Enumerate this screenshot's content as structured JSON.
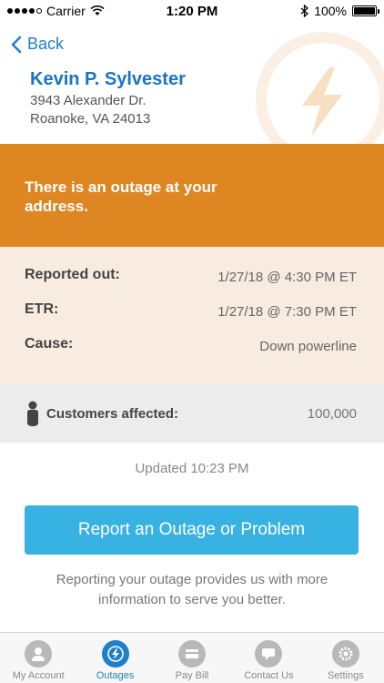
{
  "status_bar": {
    "carrier": "Carrier",
    "time": "1:20 PM",
    "battery": "100%"
  },
  "header": {
    "back_label": "Back",
    "name": "Kevin P. Sylvester",
    "address_line1": "3943 Alexander Dr.",
    "address_line2": "Roanoke, VA 24013"
  },
  "banner": {
    "message": "There is an outage at your address."
  },
  "details": {
    "reported_label": "Reported out:",
    "reported_value": "1/27/18 @ 4:30 PM  ET",
    "etr_label": "ETR:",
    "etr_value": "1/27/18 @ 7:30 PM  ET",
    "cause_label": "Cause:",
    "cause_value": "Down powerline"
  },
  "affected": {
    "label": "Customers affected:",
    "value": "100,000"
  },
  "updated": "Updated 10:23 PM",
  "report_button": "Report an Outage or Problem",
  "note": "Reporting your outage provides us with more information to serve you better.",
  "tabs": [
    {
      "label": "My Account",
      "icon": "account-icon",
      "active": false
    },
    {
      "label": "Outages",
      "icon": "bolt-icon",
      "active": true
    },
    {
      "label": "Pay Bill",
      "icon": "card-icon",
      "active": false
    },
    {
      "label": "Contact Us",
      "icon": "chat-icon",
      "active": false
    },
    {
      "label": "Settings",
      "icon": "gear-icon",
      "active": false
    }
  ],
  "colors": {
    "accent_blue": "#1f7fc8",
    "banner_orange": "#de8622",
    "details_bg": "#f8ebe0",
    "button_blue": "#38b1e3"
  }
}
